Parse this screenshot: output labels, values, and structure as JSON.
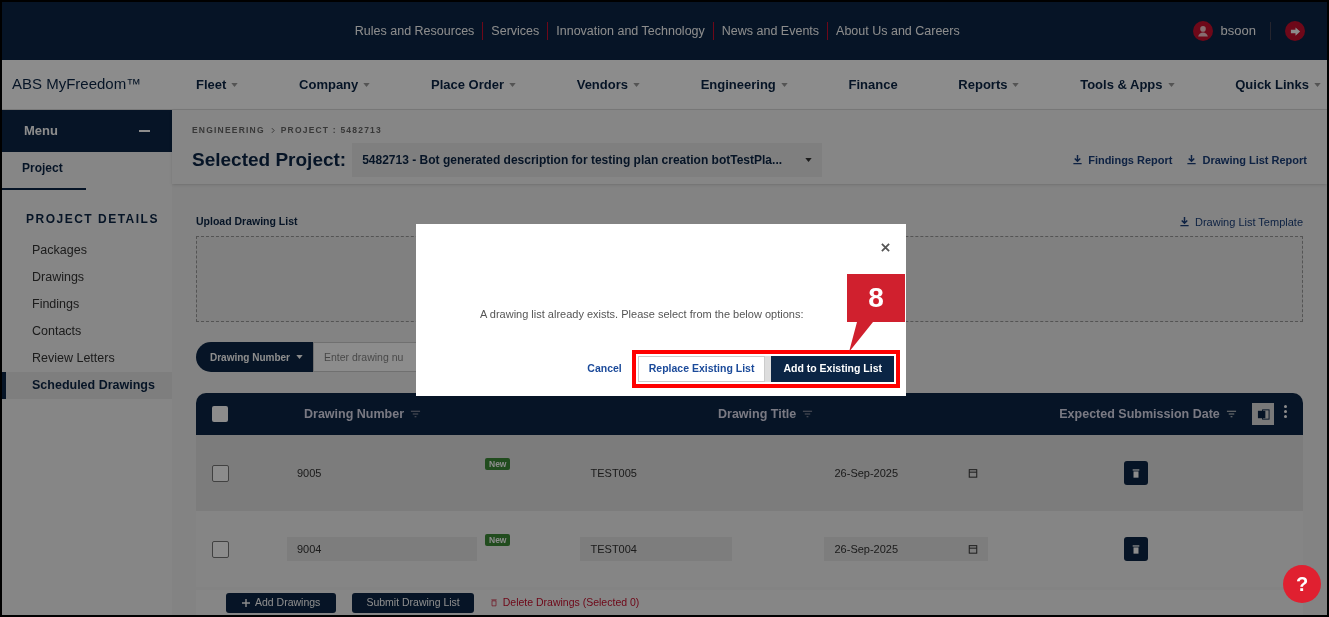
{
  "top_links": [
    "Rules and Resources",
    "Services",
    "Innovation and Technology",
    "News and Events",
    "About Us and Careers"
  ],
  "user": {
    "name": "bsoon"
  },
  "brand": "ABS MyFreedom™",
  "nav": [
    {
      "label": "Fleet",
      "caret": true
    },
    {
      "label": "Company",
      "caret": true
    },
    {
      "label": "Place Order",
      "caret": true
    },
    {
      "label": "Vendors",
      "caret": true
    },
    {
      "label": "Engineering",
      "caret": true
    },
    {
      "label": "Finance",
      "caret": false
    },
    {
      "label": "Reports",
      "caret": true
    },
    {
      "label": "Tools & Apps",
      "caret": true
    },
    {
      "label": "Quick Links",
      "caret": true
    }
  ],
  "sidebar": {
    "title": "Menu",
    "tab": "Project",
    "section": "PROJECT DETAILS",
    "items": [
      {
        "label": "Packages",
        "selected": false
      },
      {
        "label": "Drawings",
        "selected": false
      },
      {
        "label": "Findings",
        "selected": false
      },
      {
        "label": "Contacts",
        "selected": false
      },
      {
        "label": "Review Letters",
        "selected": false
      },
      {
        "label": "Scheduled Drawings",
        "selected": true
      }
    ]
  },
  "breadcrumb": [
    "ENGINEERING",
    "PROJECT : 5482713"
  ],
  "project": {
    "label": "Selected Project:",
    "value": "5482713 - Bot generated description for testing plan creation botTestPla..."
  },
  "reports": [
    "Findings Report",
    "Drawing List Report"
  ],
  "upload": {
    "title": "Upload Drawing List",
    "template": "Drawing List Template"
  },
  "search": {
    "filter": "Drawing Number",
    "placeholder": "Enter drawing nu"
  },
  "table": {
    "all_checked": false,
    "columns": [
      "Drawing Number",
      "Drawing Title",
      "Expected Submission Date"
    ],
    "rows": [
      {
        "kind": "static",
        "number": "9005",
        "badge": "New",
        "title": "TEST005",
        "date": "26-Sep-2025",
        "checked": false
      },
      {
        "kind": "editable",
        "number": "9004",
        "badge": "New",
        "title": "TEST004",
        "date": "26-Sep-2025",
        "checked": false
      }
    ]
  },
  "footer": {
    "add": "Add Drawings",
    "submit": "Submit Drawing List",
    "delete": "Delete Drawings (Selected 0)"
  },
  "help": "?",
  "modal": {
    "message": "A drawing list already exists. Please select from the below options:",
    "cancel": "Cancel",
    "replace": "Replace Existing List",
    "add": "Add to Existing List"
  },
  "callout": "8"
}
